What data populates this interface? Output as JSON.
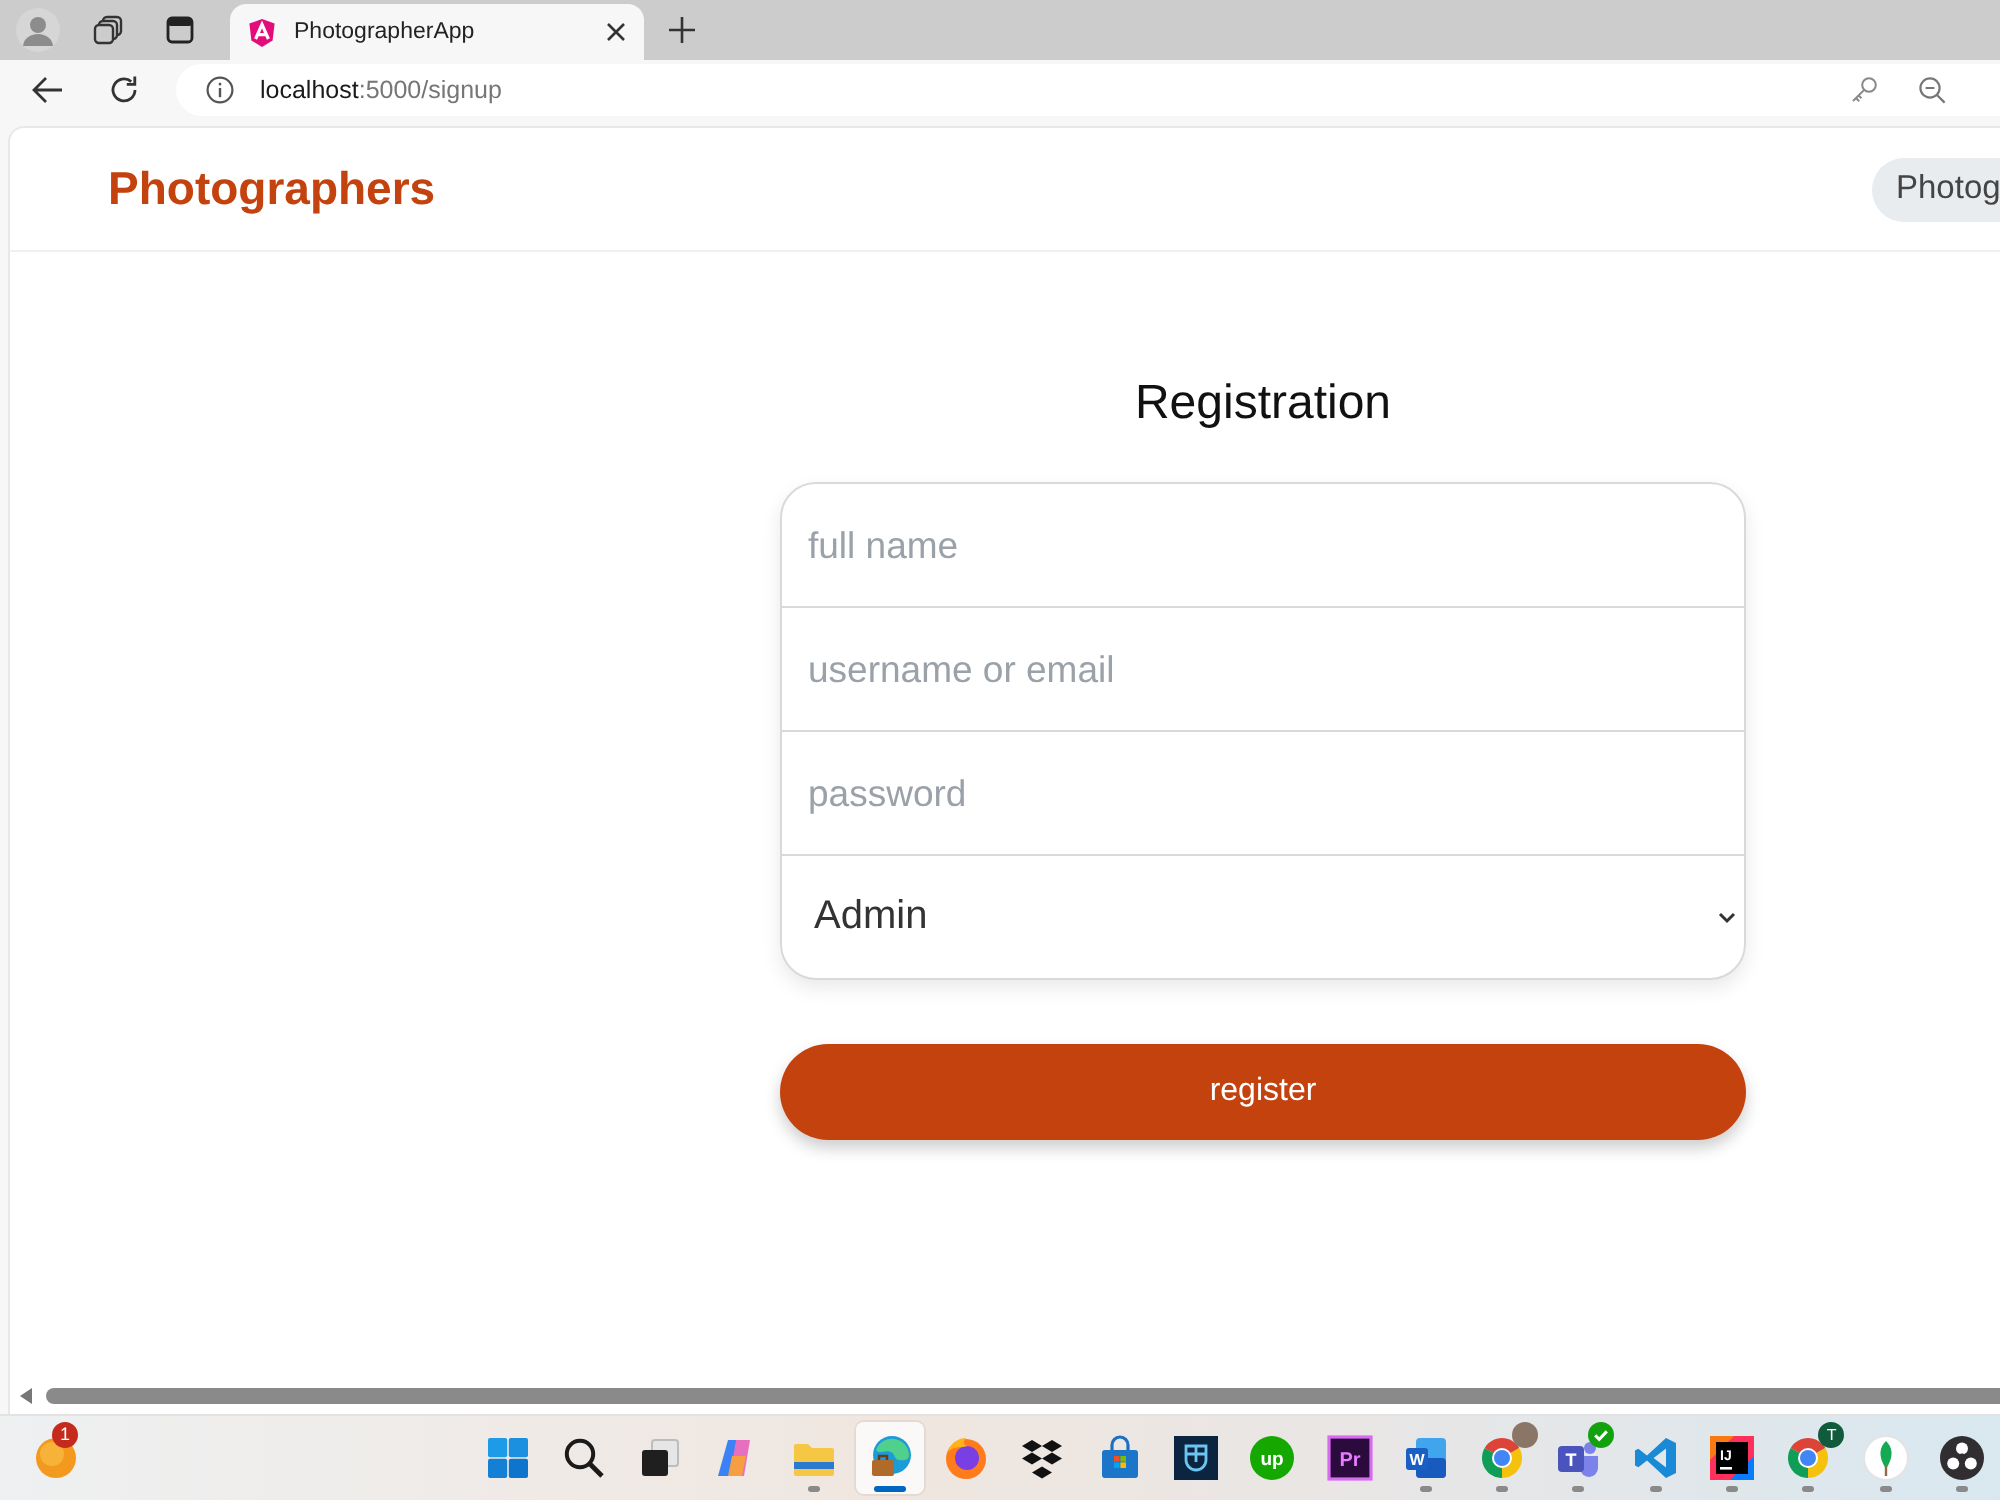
{
  "browser": {
    "tabs": [
      {
        "title": "PhotographerApp",
        "selected": true
      }
    ],
    "address": {
      "host": "localhost",
      "rest": ":5000/signup"
    }
  },
  "navbar": {
    "brand": "Photographers",
    "nav_button": "Photog"
  },
  "form": {
    "title": "Registration",
    "fields": [
      {
        "kind": "text",
        "placeholder": "full name"
      },
      {
        "kind": "text",
        "placeholder": "username or email"
      },
      {
        "kind": "password",
        "placeholder": "password"
      },
      {
        "kind": "select",
        "value": "Admin"
      }
    ],
    "submit": "register"
  },
  "taskbar": {
    "widget_badge": "1",
    "apps": [
      {
        "kind": "start",
        "running": false,
        "selected": false
      },
      {
        "kind": "search",
        "running": false,
        "selected": false
      },
      {
        "kind": "taskview",
        "running": false,
        "selected": false
      },
      {
        "kind": "swirl",
        "running": false,
        "selected": false
      },
      {
        "kind": "folder",
        "running": true,
        "selected": false
      },
      {
        "kind": "wave",
        "running": true,
        "selected": true
      },
      {
        "kind": "fox",
        "running": false,
        "selected": false
      },
      {
        "kind": "boxes",
        "running": false,
        "selected": false
      },
      {
        "kind": "bag",
        "running": false,
        "selected": false
      },
      {
        "kind": "tile",
        "running": false,
        "selected": false
      },
      {
        "kind": "disc",
        "label": "up",
        "running": false,
        "selected": false
      },
      {
        "kind": "framed",
        "label": "Pr",
        "running": false,
        "selected": false
      },
      {
        "kind": "doc",
        "label": "W",
        "running": true,
        "selected": false
      },
      {
        "kind": "ring",
        "badge": {
          "kind": "avatar"
        },
        "running": true,
        "selected": false
      },
      {
        "kind": "people",
        "label": "T",
        "badge": {
          "kind": "check"
        },
        "running": true,
        "selected": false
      },
      {
        "kind": "ribbon",
        "running": true,
        "selected": false
      },
      {
        "kind": "gradient",
        "label": "IJ",
        "running": true,
        "selected": false
      },
      {
        "kind": "ring",
        "badge": {
          "kind": "letter",
          "text": "T"
        },
        "running": true,
        "selected": false
      },
      {
        "kind": "leaf",
        "running": true,
        "selected": false
      },
      {
        "kind": "aperture",
        "running": true,
        "selected": false
      }
    ]
  }
}
